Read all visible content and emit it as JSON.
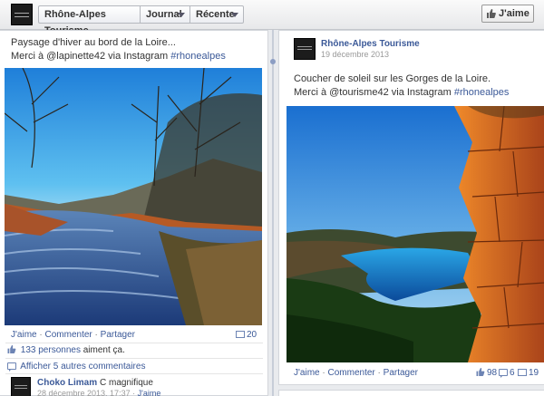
{
  "topbar": {
    "page_name": "Rhône-Alpes Tourisme",
    "menu_journal": "Journal",
    "menu_recent": "Récente",
    "like_button": "J'aime"
  },
  "colors": {
    "link": "#3b5998",
    "text": "#333333",
    "background": "#e9ebee"
  },
  "left_post": {
    "text_line1": "Paysage d'hiver au bord de la Loire...",
    "text_line2_prefix": "Merci à @lapinette42 via Instagram",
    "hashtag": "#rhonealpes",
    "actions": {
      "like": "J'aime",
      "comment": "Commenter",
      "share": "Partager",
      "separator": "·"
    },
    "shares_count": "20",
    "likes_text": "133 personnes",
    "likes_suffix": "aiment ça.",
    "more_comments": "Afficher 5 autres commentaires",
    "comment": {
      "author": "Choko Limam",
      "text": "C magnifique",
      "date": "28 décembre 2013, 17:37",
      "like": "J'aime"
    },
    "icons": [
      "thumbs-up-icon",
      "comment-icon",
      "share-icon"
    ]
  },
  "right_post": {
    "author": "Rhône-Alpes Tourisme",
    "date": "19 décembre 2013",
    "text_line1": "Coucher de soleil sur les Gorges de la Loire.",
    "text_line2_prefix": "Merci à @tourisme42 via Instagram",
    "hashtag": "#rhonealpes",
    "actions": {
      "like": "J'aime",
      "comment": "Commenter",
      "share": "Partager",
      "separator": "·"
    },
    "likes_count": "98",
    "comments_count": "6",
    "shares_count": "19"
  }
}
